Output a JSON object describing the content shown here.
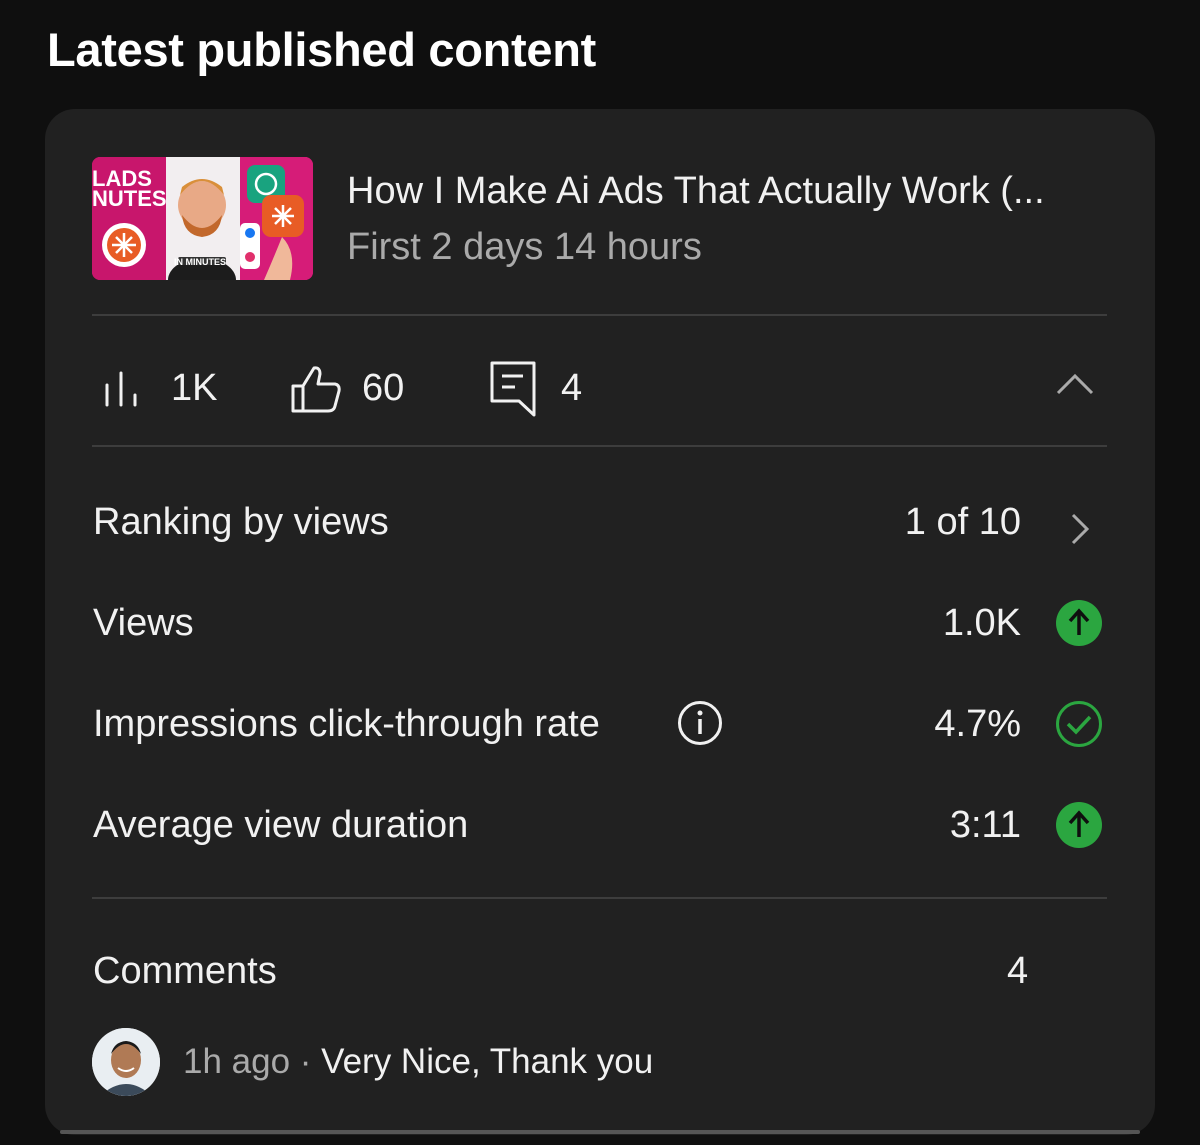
{
  "section": {
    "title": "Latest published content"
  },
  "thumbnail": {
    "text_lines": [
      "LADS",
      "NUTES"
    ],
    "badge": "IN MINUTES",
    "brand_color": "#c8166c"
  },
  "video": {
    "title": "How I Make Ai Ads That Actually Work (...",
    "subtitle": "First 2 days 14 hours"
  },
  "stats": {
    "views": "1K",
    "likes": "60",
    "comments": "4"
  },
  "metrics": [
    {
      "label": "Ranking by views",
      "value": "1 of 10",
      "indicator": "chevron-right-icon"
    },
    {
      "label": "Views",
      "value": "1.0K",
      "indicator": "arrow-up-icon"
    },
    {
      "label": "Impressions click-through rate",
      "value": "4.7%",
      "indicator": "check-circle-icon"
    },
    {
      "label": "Average view duration",
      "value": "3:11",
      "indicator": "arrow-up-icon"
    }
  ],
  "comments_section": {
    "label": "Comments",
    "count": "4",
    "latest": {
      "time": "1h ago",
      "separator": " · ",
      "text": "Very Nice, Thank you"
    }
  },
  "colors": {
    "accent_green": "#2ba640",
    "background": "#0f0f0f",
    "card": "#212121"
  }
}
